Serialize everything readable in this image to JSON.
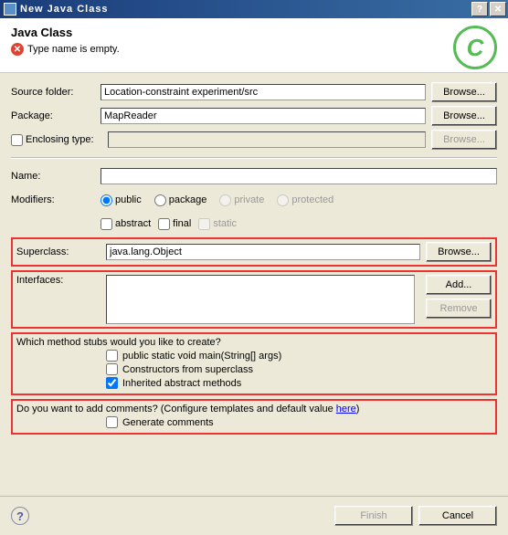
{
  "window": {
    "title": "New Java Class"
  },
  "header": {
    "title": "Java Class",
    "error": "Type name is empty."
  },
  "labels": {
    "sourceFolder": "Source folder:",
    "package": "Package:",
    "enclosingType": "Enclosing type:",
    "name": "Name:",
    "modifiers": "Modifiers:",
    "superclass": "Superclass:",
    "interfaces": "Interfaces:",
    "stubQuestion": "Which method stubs would you like to create?",
    "commentsQuestion": "Do you want to add comments? (Configure templates and default value ",
    "here": "here",
    "closeParen": ")"
  },
  "fields": {
    "sourceFolder": "Location-constraint experiment/src",
    "package": "MapReader",
    "enclosingType": "",
    "name": "",
    "superclass": "java.lang.Object"
  },
  "modifiers": {
    "radios": {
      "public": "public",
      "package": "package",
      "private": "private",
      "protected": "protected"
    },
    "checks": {
      "abstract": "abstract",
      "final": "final",
      "static": "static"
    }
  },
  "stubs": {
    "main": "public static void main(String[] args)",
    "super": "Constructors from superclass",
    "inherited": "Inherited abstract methods",
    "gen": "Generate comments"
  },
  "buttons": {
    "browse": "Browse...",
    "add": "Add...",
    "remove": "Remove",
    "finish": "Finish",
    "cancel": "Cancel"
  }
}
